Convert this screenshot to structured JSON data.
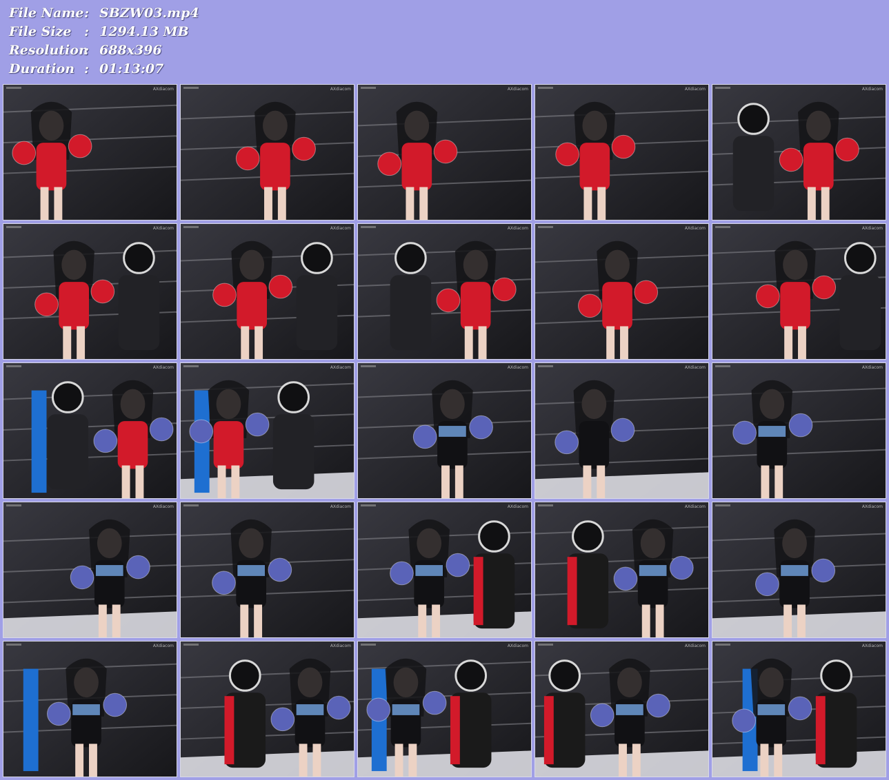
{
  "file_info": {
    "rows": [
      {
        "label": "File Name",
        "sep": ":",
        "value": "SBZW03.mp4"
      },
      {
        "label": "File Size",
        "sep": ":",
        "value": "1294.13 MB"
      },
      {
        "label": "Resolution",
        "sep": ":",
        "value": "688x396"
      },
      {
        "label": "Duration",
        "sep": ":",
        "value": "01:13:07"
      }
    ]
  },
  "colors": {
    "page_background": "#a09fe6",
    "info_text": "#ffffff",
    "ring_dark": "#2a2a30",
    "ring_rope": "#8a8a90",
    "red_suit": "#d21a2a",
    "blue_glove": "#5a63b8",
    "ring_pad_blue": "#1e6fd1",
    "canvas_white": "#dcdce2"
  },
  "thumbnails": [
    {
      "watermark": "AXdiacom",
      "scene": "closeup-red-glove"
    },
    {
      "watermark": "AXdiacom",
      "scene": "low-angle-red-suit"
    },
    {
      "watermark": "AXdiacom",
      "scene": "low-angle-red-gloves"
    },
    {
      "watermark": "AXdiacom",
      "scene": "pose-red-gloves"
    },
    {
      "watermark": "AXdiacom",
      "scene": "masked-man-vs-red"
    },
    {
      "watermark": "AXdiacom",
      "scene": "red-vs-masked-wide"
    },
    {
      "watermark": "AXdiacom",
      "scene": "punch-body"
    },
    {
      "watermark": "AXdiacom",
      "scene": "hair-whip-punch"
    },
    {
      "watermark": "AXdiacom",
      "scene": "back-red-suit"
    },
    {
      "watermark": "AXdiacom",
      "scene": "clinch-masked"
    },
    {
      "watermark": "AXdiacom",
      "scene": "ground-blue-pad"
    },
    {
      "watermark": "AXdiacom",
      "scene": "mount-masked"
    },
    {
      "watermark": "AXdiacom",
      "scene": "closeup-blue-gloves"
    },
    {
      "watermark": "AXdiacom",
      "scene": "denim-top-closeup"
    },
    {
      "watermark": "AXdiacom",
      "scene": "denim-pose"
    },
    {
      "watermark": "AXdiacom",
      "scene": "back-black-shorts"
    },
    {
      "watermark": "AXdiacom",
      "scene": "face-closeup-gloves"
    },
    {
      "watermark": "AXdiacom",
      "scene": "blue-vs-red-gloves"
    },
    {
      "watermark": "AXdiacom",
      "scene": "clinch-red-man"
    },
    {
      "watermark": "AXdiacom",
      "scene": "face-glove-closeup"
    },
    {
      "watermark": "AXdiacom",
      "scene": "bent-over-ring"
    },
    {
      "watermark": "AXdiacom",
      "scene": "masked-red-vs-woman"
    },
    {
      "watermark": "AXdiacom",
      "scene": "knee-down-ring"
    },
    {
      "watermark": "AXdiacom",
      "scene": "mount-ground"
    },
    {
      "watermark": "AXdiacom",
      "scene": "pin-blue-pad"
    }
  ]
}
